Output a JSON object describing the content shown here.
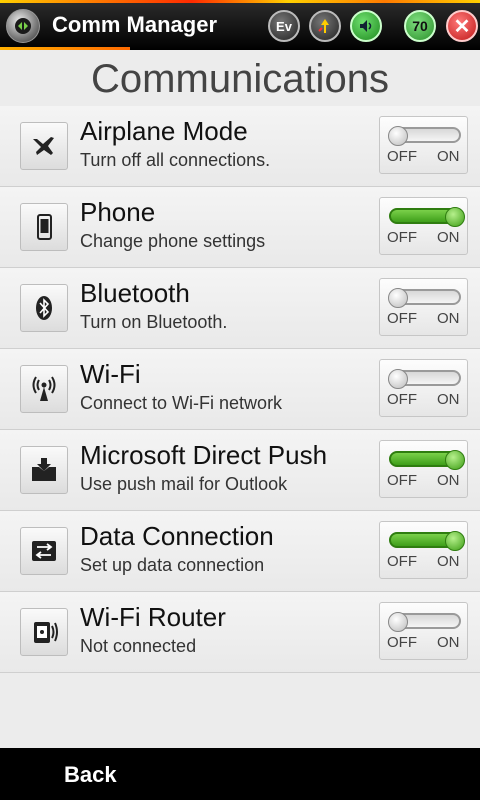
{
  "titlebar": {
    "app_title": "Comm Manager",
    "tray": {
      "ev_label": "Ev",
      "battery_label": "70",
      "close_symbol": "✕"
    }
  },
  "page": {
    "title": "Communications"
  },
  "items": [
    {
      "title": "Airplane Mode",
      "subtitle": "Turn off all connections.",
      "icon": "airplane-icon",
      "state": "off",
      "off_label": "OFF",
      "on_label": "ON"
    },
    {
      "title": "Phone",
      "subtitle": "Change phone settings",
      "icon": "phone-icon",
      "state": "on",
      "off_label": "OFF",
      "on_label": "ON"
    },
    {
      "title": "Bluetooth",
      "subtitle": "Turn on Bluetooth.",
      "icon": "bluetooth-icon",
      "state": "off",
      "off_label": "OFF",
      "on_label": "ON"
    },
    {
      "title": "Wi-Fi",
      "subtitle": "Connect to Wi-Fi network",
      "icon": "wifi-icon",
      "state": "off",
      "off_label": "OFF",
      "on_label": "ON"
    },
    {
      "title": "Microsoft Direct Push",
      "subtitle": "Use push mail for Outlook",
      "icon": "push-mail-icon",
      "state": "on",
      "off_label": "OFF",
      "on_label": "ON"
    },
    {
      "title": "Data Connection",
      "subtitle": "Set up data connection",
      "icon": "data-connection-icon",
      "state": "on",
      "off_label": "OFF",
      "on_label": "ON"
    },
    {
      "title": "Wi-Fi Router",
      "subtitle": "Not connected",
      "icon": "wifi-router-icon",
      "state": "off",
      "off_label": "OFF",
      "on_label": "ON"
    }
  ],
  "bottombar": {
    "back_label": "Back"
  },
  "colors": {
    "toggle_on": "#3f9f1a",
    "titlebar_bg": "#000000",
    "accent": "#ff7a00"
  }
}
